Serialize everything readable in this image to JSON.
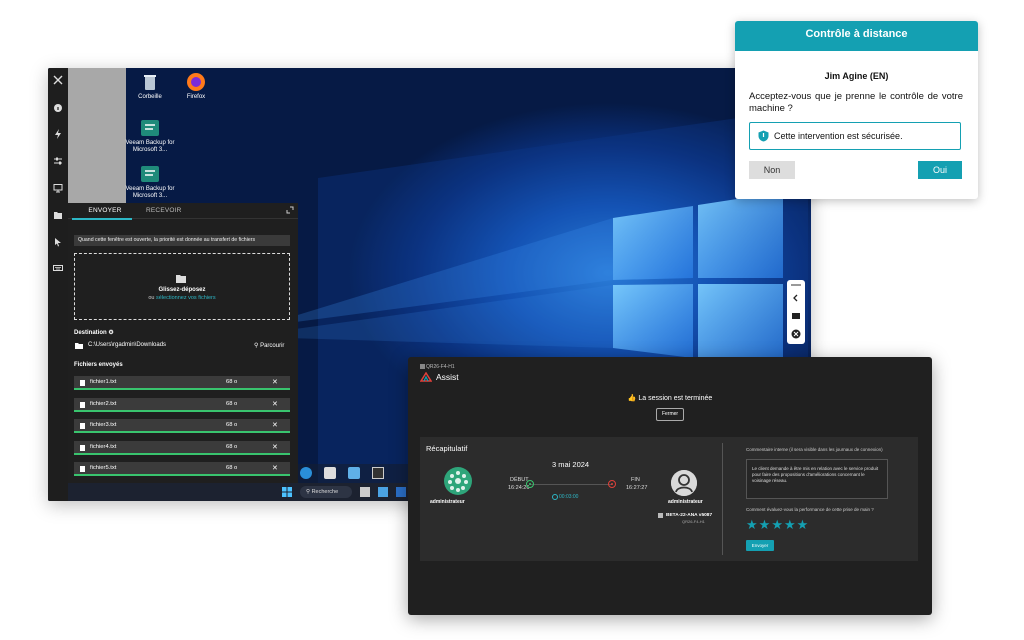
{
  "desktop": {
    "icons": [
      {
        "label": "Corbeille",
        "icon": "recycle-bin-icon"
      },
      {
        "label": "Firefox",
        "icon": "firefox-icon"
      },
      {
        "label": "Veeam Backup for Microsoft 3...",
        "icon": "veeam-icon"
      },
      {
        "label": "Veeam Backup for Microsoft 3...",
        "icon": "veeam-icon"
      }
    ],
    "taskbar": {
      "search_label": "Recherche"
    }
  },
  "transfer": {
    "tabs": {
      "send": "ENVOYER",
      "receive": "RECEVOIR"
    },
    "notice": "Quand cette fenêtre est ouverte, la priorité est donnée au transfert de fichiers",
    "drop_title": "Glissez-déposez",
    "drop_or": "ou",
    "drop_link": "sélectionnez vos fichiers",
    "destination_label": "Destination",
    "destination_path": "C:\\Users\\rgadmin\\Downloads",
    "browse_label": "Parcourir",
    "sent_label": "Fichiers envoyés",
    "files": [
      {
        "name": "fichier1.txt",
        "size": "68 o"
      },
      {
        "name": "fichier2.txt",
        "size": "68 o"
      },
      {
        "name": "fichier3.txt",
        "size": "68 o"
      },
      {
        "name": "fichier4.txt",
        "size": "68 o"
      },
      {
        "name": "fichier5.txt",
        "size": "68 o"
      }
    ]
  },
  "remote_dialog": {
    "title": "Contrôle à distance",
    "name": "Jim Agine (EN)",
    "question": "Acceptez-vous que je prenne le contrôle de votre machine ?",
    "secure_text": "Cette intervention est sécurisée.",
    "no_label": "Non",
    "yes_label": "Oui"
  },
  "assist": {
    "window_id": "QR26-F4-H1",
    "title": "Assist",
    "ended_text": "La session est terminée",
    "close_label": "Fermer",
    "recap_title": "Récapitulatif",
    "date": "3 mai 2024",
    "start_label": "DÉBUT",
    "start_time": "16:24:26",
    "end_label": "FIN",
    "end_time": "16:27:27",
    "duration": "00:03:00",
    "agent_name": "administrateur",
    "client_name": "administrateur",
    "host_name": "BETA-22-ANA v5087",
    "host_id": "QR26-F4-H1",
    "comment_label": "Commentaire interne (il sera visible dans les journaux de connexion)",
    "comment_text": "Le client demande à être mis en relation avec le service produit pour faire des propositions d'améliorations concernant le voisinage réseau.",
    "rating_label": "Comment évaluez-vous la performance de cette prise de main ?",
    "rating": 5,
    "send_label": "Envoyer",
    "colors": {
      "accent": "#14a0b2",
      "success": "#39c46e",
      "danger": "#e0403a"
    }
  }
}
